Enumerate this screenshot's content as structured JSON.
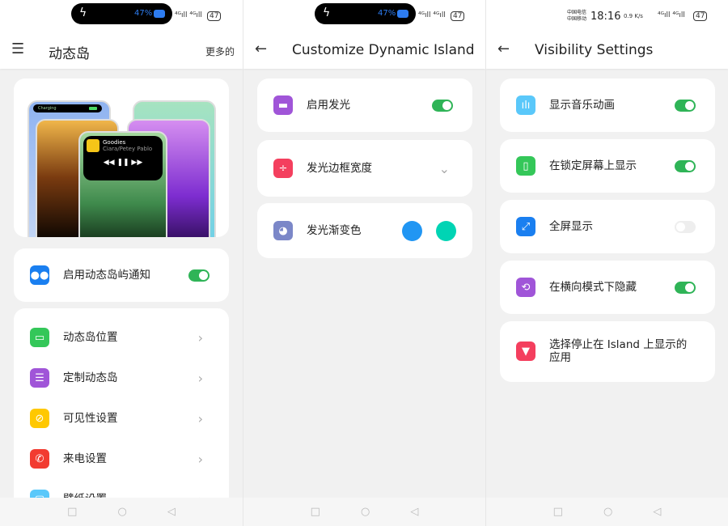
{
  "status": {
    "battery_pct": "47%",
    "battery_level": "47",
    "time": "18:16",
    "carrier1": "中国电信",
    "carrier2": "中国移动",
    "net_speed": "0.9 K/s",
    "signal": "⁴ᴳıll ⁴ᴳıll"
  },
  "panel1": {
    "title": "动态岛",
    "more_label": "更多的",
    "hero": {
      "track": "Goodies",
      "artist": "Ciara/Petey Pablo",
      "charging": "Charging"
    },
    "notify_label": "启用动态岛屿通知",
    "notify_on": true,
    "items": [
      {
        "label": "动态岛位置",
        "icon": "window-icon",
        "color": "#34c759"
      },
      {
        "label": "定制动态岛",
        "icon": "sliders-icon",
        "color": "#a055d8"
      },
      {
        "label": "可见性设置",
        "icon": "eye-off-icon",
        "color": "#ffc800"
      },
      {
        "label": "来电设置",
        "icon": "phone-icon",
        "color": "#f23b30"
      },
      {
        "label": "壁纸设置",
        "icon": "wallpaper-icon",
        "color": "#5ac8fa"
      }
    ]
  },
  "panel2": {
    "title": "Customize Dynamic Island",
    "items": [
      {
        "label": "启用发光",
        "icon": "glow-icon",
        "color": "#a055d8",
        "toggle": true
      },
      {
        "label": "发光边框宽度",
        "icon": "border-width-icon",
        "color": "#f43f5e"
      },
      {
        "label": "发光渐变色",
        "icon": "palette-icon",
        "color": "#7b87c8",
        "colors": [
          "#2196f3",
          "#00d4b4"
        ]
      }
    ]
  },
  "panel3": {
    "title": "Visibility Settings",
    "items": [
      {
        "label": "显示音乐动画",
        "icon": "waveform-icon",
        "color": "#5ac8fa",
        "on": true
      },
      {
        "label": "在锁定屏幕上显示",
        "icon": "lock-screen-icon",
        "color": "#34c759",
        "on": true
      },
      {
        "label": "全屏显示",
        "icon": "fullscreen-icon",
        "color": "#1a7ff0",
        "on": false
      },
      {
        "label": "在横向模式下隐藏",
        "icon": "rotate-icon",
        "color": "#a055d8",
        "on": true
      },
      {
        "label": "选择停止在 Island 上显示的应用",
        "icon": "filter-icon",
        "color": "#f43f5e"
      }
    ]
  }
}
